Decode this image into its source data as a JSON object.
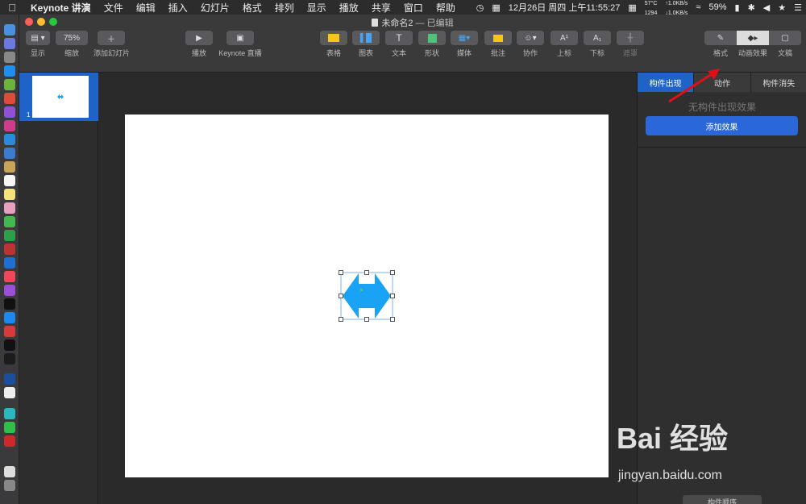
{
  "menubar": {
    "app_name": "Keynote 讲演",
    "items": [
      "文件",
      "编辑",
      "插入",
      "幻灯片",
      "格式",
      "排列",
      "显示",
      "播放",
      "共享",
      "窗口",
      "帮助"
    ],
    "datetime": "12月26日 周四 上午11:55:27",
    "temp": "57°C",
    "fan": "1294",
    "net_up": "↑1.0KB/s",
    "net_down": "↓1.0KB/s",
    "battery": "59%"
  },
  "window": {
    "title": "未命名2",
    "status": " — 已编辑"
  },
  "toolbar": {
    "view": "显示",
    "zoom_value": "75%",
    "zoom": "缩放",
    "add_slide": "添加幻灯片",
    "play": "播放",
    "keynote_live": "Keynote 直播",
    "table": "表格",
    "chart": "图表",
    "text": "文本",
    "shape": "形状",
    "media": "媒体",
    "comment": "批注",
    "collaborate": "协作",
    "superscript": "上标",
    "subscript": "下标",
    "mask": "遮罩",
    "format": "格式",
    "animate": "动画效果",
    "document": "文稿"
  },
  "slidenav": {
    "slide_number": "1"
  },
  "inspector": {
    "tabs": [
      "构件出现",
      "动作",
      "构件消失"
    ],
    "no_effect": "无构件出现效果",
    "add_effect": "添加效果",
    "build_order": "构件顺序"
  },
  "watermark": {
    "brand": "Bai 经验",
    "url": "jingyan.baidu.com"
  },
  "colors": {
    "accent": "#1f63c9",
    "shape": "#1aa3f5",
    "arrow_annotation": "#e0101a"
  }
}
